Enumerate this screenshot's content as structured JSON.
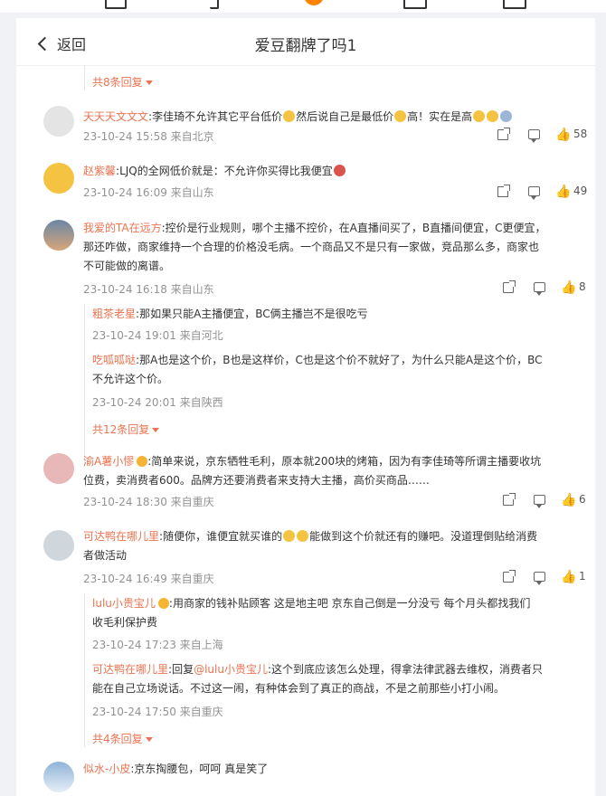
{
  "header": {
    "back_label": "返回",
    "title": "爱豆翻牌了吗1"
  },
  "threads": [
    {
      "more": "共8条回复"
    },
    {
      "user": "天天天文文文",
      "text": "李佳琦不允许其它平台低价",
      "text2": "然后说自己是最低价",
      "text3": "高！实在是高",
      "time": "23-10-24 15:58 来自北京",
      "likes": "58"
    },
    {
      "user": "赵紫馨",
      "text": "LJQ的全网低价就是：不允许你买得比我便宜",
      "time": "23-10-24 16:09 来自山东",
      "likes": "49"
    },
    {
      "user": "我爱的TA在远方",
      "text": "控价是行业规则，哪个主播不控价，在A直播间买了，B直播间便宜，C更便宜，",
      "line2": "那还咋做，商家维持一个合理的价格没毛病。一个商品又不是只有一家做，竞品那么多，商家也",
      "line3": "不可能做的离谱。",
      "time": "23-10-24 16:18 来自山东",
      "likes": "8",
      "replies": [
        {
          "user": "粗茶老星",
          "text": "那如果只能A主播便宜，BC俩主播岂不是很吃亏",
          "time": "23-10-24 19:01 来自河北"
        },
        {
          "user": "吃呱呱哒",
          "text": "那A也是这个价，B也是这样价，C也是这个价不就好了，为什么只能A是这个价，BC",
          "line2": "不允许这个价。",
          "time": "23-10-24 20:01 来自陕西"
        }
      ],
      "more": "共12条回复"
    },
    {
      "user": "渝A薯小憀",
      "text": "简单来说，京东牺牲毛利，原本就200块的烤箱，因为有李佳琦等所谓主播要收坑",
      "line2": "位费，卖消费者600。品牌方还要消费者来支持大主播，高价买商品……",
      "time": "23-10-24 18:30 来自重庆",
      "likes": "6"
    },
    {
      "user": "可达鸭在哪儿里",
      "text": "随便你，谁便宜就买谁的",
      "text2": "能做到这个价就还有的赚吧。没道理倒贴给消费",
      "line2": "者做活动",
      "time": "23-10-24 16:49 来自重庆",
      "likes": "1",
      "replies": [
        {
          "user": "lulu小贵宝儿",
          "text": "用商家的钱补贴顾客  这是地主吧  京东自己倒是一分没亏  每个月头都找我们",
          "line2": "收毛利保护费",
          "time": "23-10-24 17:23 来自上海"
        },
        {
          "user": "可达鸭在哪儿里",
          "prefix": "回复",
          "mention": "@lulu小贵宝儿",
          "text": "这个到底应该怎么处理，得拿法律武器去维权，消费者只",
          "line2": "能在自己立场说话。不过这一闹，有种体会到了真正的商战，不是之前那些小打小闹。",
          "time": "23-10-24 17:50 来自重庆"
        }
      ],
      "more": "共4条回复"
    },
    {
      "user": "似水-小皮",
      "text": "京东掏腰包，呵呵 真是笑了"
    }
  ],
  "icons": {
    "forward": "forward-icon",
    "comment": "comment-icon",
    "like": "like-icon"
  },
  "colors": {
    "accent": "#ff8200",
    "username": "#eb7350",
    "meta": "#939393"
  }
}
